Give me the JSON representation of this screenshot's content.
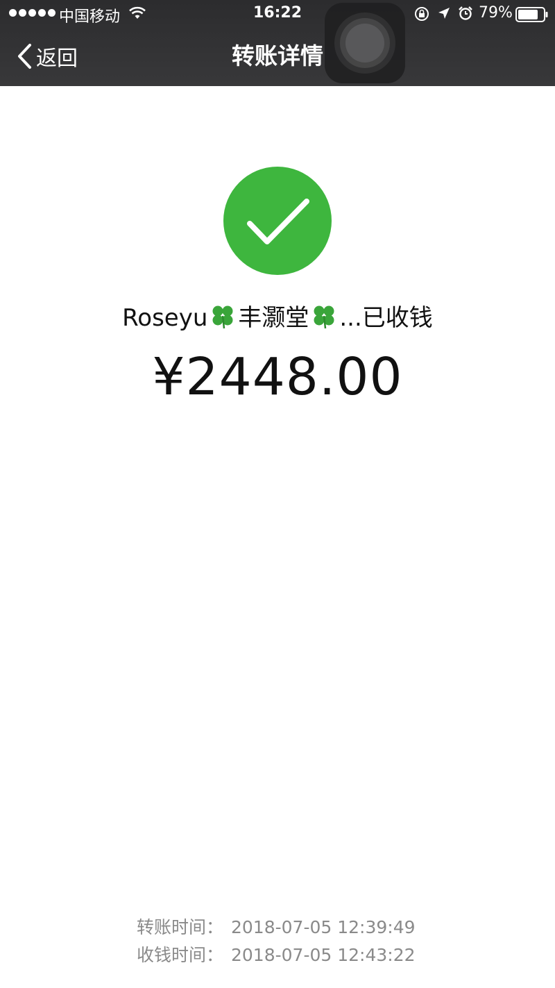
{
  "status_bar": {
    "carrier": "中国移动",
    "time": "16:22",
    "battery": "79%",
    "battery_level": 0.79
  },
  "nav": {
    "back_label": "返回",
    "title": "转账详情"
  },
  "transfer": {
    "receiver_name_part1": "Roseyu",
    "receiver_name_part2": "丰灏堂",
    "receiver_suffix": "...已收钱",
    "amount": "¥2448.00"
  },
  "times": [
    {
      "label": "转账时间：",
      "value": "2018-07-05 12:39:49"
    },
    {
      "label": "收钱时间：",
      "value": "2018-07-05 12:43:22"
    }
  ],
  "colors": {
    "success_green": "#3eb63e",
    "nav_bar": "#2f2f31",
    "secondary_text": "#8a8a8a"
  },
  "icons": [
    "signal-dots-icon",
    "wifi-icon",
    "orientation-lock-icon",
    "location-arrow-icon",
    "alarm-icon",
    "battery-icon",
    "back-chevron-icon",
    "success-check-icon",
    "four-leaf-clover-icon"
  ]
}
